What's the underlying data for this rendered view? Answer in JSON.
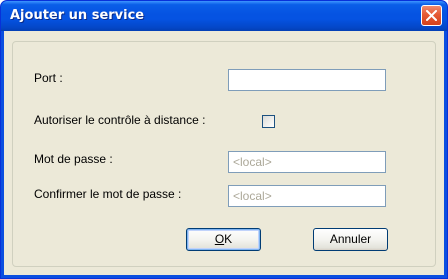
{
  "window": {
    "title": "Ajouter un service"
  },
  "form": {
    "port_label": "Port :",
    "port_value": "",
    "remote_label": "Autoriser le contrôle à distance :",
    "remote_checked": false,
    "password_label": "Mot de passe :",
    "password_placeholder": "<local>",
    "confirm_label": "Confirmer le mot de passe :",
    "confirm_placeholder": "<local>"
  },
  "buttons": {
    "ok_mnemonic": "O",
    "ok_rest": "K",
    "cancel_label": "Annuler"
  },
  "colors": {
    "titlebar": "#0553e2",
    "close_button": "#e55a34",
    "dialog_background": "#ece9d8"
  }
}
